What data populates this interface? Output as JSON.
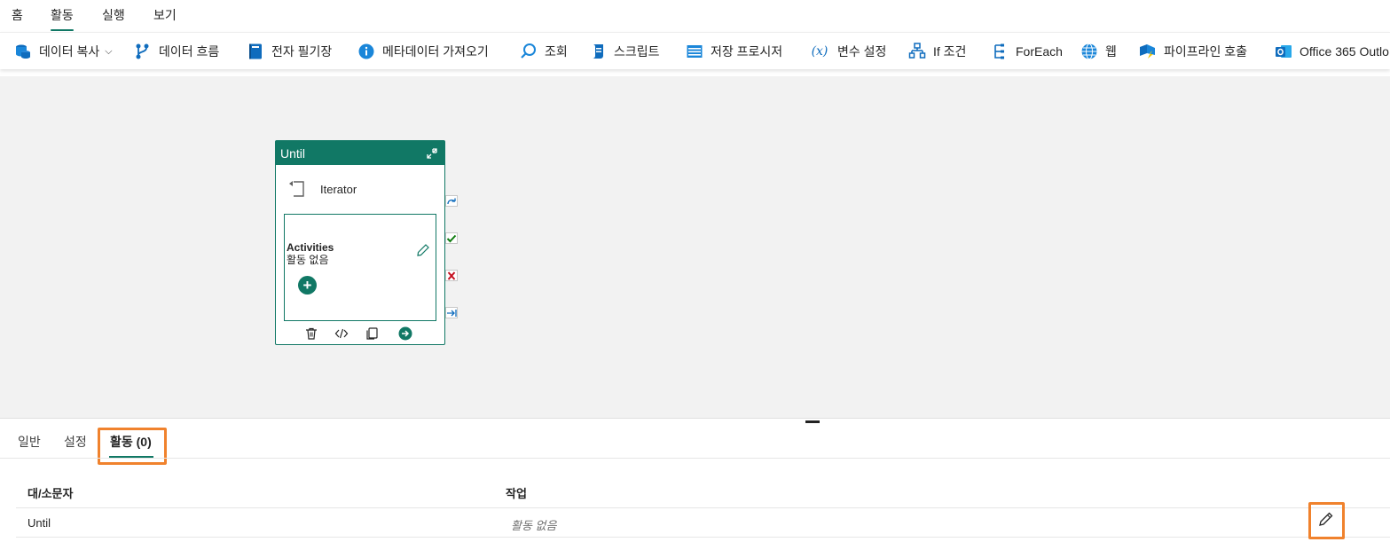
{
  "menu_tabs": [
    {
      "label": "홈"
    },
    {
      "label": "활동",
      "active": true
    },
    {
      "label": "실행"
    },
    {
      "label": "보기"
    }
  ],
  "ribbon": {
    "items": [
      {
        "label": "데이터 복사",
        "icon": "copy-data-icon",
        "has_dropdown": true
      },
      {
        "label": "데이터 흐름",
        "icon": "dataflow-icon"
      },
      {
        "label": "전자 필기장",
        "icon": "notebook-icon"
      },
      {
        "label": "메타데이터 가져오기",
        "icon": "info-icon"
      },
      {
        "label": "조회",
        "icon": "lookup-icon"
      },
      {
        "label": "스크립트",
        "icon": "script-icon"
      },
      {
        "label": "저장 프로시저",
        "icon": "stored-procedure-icon"
      },
      {
        "label": "변수 설정",
        "icon": "variable-icon"
      },
      {
        "label": "If 조건",
        "icon": "if-condition-icon"
      },
      {
        "label": "ForEach",
        "icon": "foreach-icon"
      },
      {
        "label": "웹",
        "icon": "globe-icon"
      },
      {
        "label": "파이프라인 호출",
        "icon": "invoke-pipeline-icon"
      },
      {
        "label": "Office 365 Outlo",
        "icon": "outlook-icon"
      }
    ],
    "dropdown_glyph": "⌵"
  },
  "canvas": {
    "until_card": {
      "title": "Until",
      "iterator_label": "Iterator",
      "inner": {
        "title": "Activities",
        "subtitle": "활동 없음",
        "add_glyph": "+"
      }
    }
  },
  "bottom_panel": {
    "tabs": [
      {
        "label": "일반"
      },
      {
        "label": "설정"
      },
      {
        "label": "활동 (0)",
        "active": true
      }
    ],
    "table": {
      "headers": [
        "대/소문자",
        "작업"
      ],
      "rows": [
        {
          "case": "Until",
          "activities": "활동 없음"
        }
      ]
    }
  },
  "colors": {
    "accent": "#117865",
    "highlight": "#f0822d",
    "canvas_bg": "#f2f2f2"
  }
}
